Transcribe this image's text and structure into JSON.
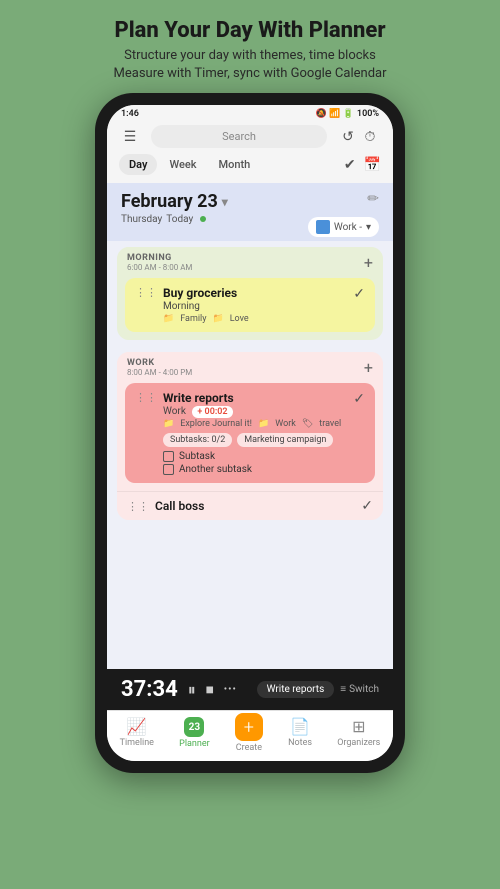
{
  "header": {
    "title": "Plan Your Day With Planner",
    "subtitle_line1": "Structure your day with themes, time blocks",
    "subtitle_line2": "Measure with Timer, sync with Google Calendar"
  },
  "status_bar": {
    "time": "1:46",
    "battery": "100%",
    "icons": "⚙ 🔒"
  },
  "top_nav": {
    "menu_icon": "☰",
    "search_placeholder": "Search",
    "refresh_icon": "↺",
    "timer_icon": "⏱"
  },
  "view_tabs": {
    "tabs": [
      "Day",
      "Week",
      "Month"
    ],
    "active_tab": "Day",
    "right_icons": [
      "✓☰",
      "📅"
    ]
  },
  "date_section": {
    "date": "February 23",
    "chevron": "▾",
    "edit_icon": "✏",
    "day_name": "Thursday",
    "today_label": "Today",
    "work_tag": "Work -",
    "work_tag_arrow": "▾"
  },
  "morning_section": {
    "title": "MORNING",
    "time": "6:00 AM - 8:00 AM",
    "add_icon": "+",
    "task": {
      "name": "Buy groceries",
      "sub": "Morning",
      "tags": [
        "Family",
        "Love"
      ],
      "checked": true
    }
  },
  "work_section": {
    "title": "WORK",
    "time": "8:00 AM - 4:00 PM",
    "add_icon": "+",
    "tasks": [
      {
        "name": "Write reports",
        "sub": "Work",
        "timer_badge": "+ 00:02",
        "tags": [
          "Explore Journal it!",
          "Work",
          "travel"
        ],
        "subtask_badges": [
          "Subtasks: 0/2",
          "Marketing campaign"
        ],
        "subtasks": [
          "Subtask",
          "Another subtask"
        ],
        "checked": true
      },
      {
        "name": "Call boss",
        "checked": true
      }
    ]
  },
  "timer_bar": {
    "time": "37:34",
    "pause_icon": "⏸",
    "stop_icon": "⏹",
    "more_icon": "•••",
    "label": "Write reports",
    "switch_icon": "≡",
    "switch_label": "Switch"
  },
  "bottom_nav": {
    "items": [
      {
        "label": "Timeline",
        "icon": "📈"
      },
      {
        "label": "Planner",
        "icon": "23",
        "active": true
      },
      {
        "label": "Create",
        "icon": "+"
      },
      {
        "label": "Notes",
        "icon": "📄"
      },
      {
        "label": "Organizers",
        "icon": "⊞"
      }
    ]
  }
}
